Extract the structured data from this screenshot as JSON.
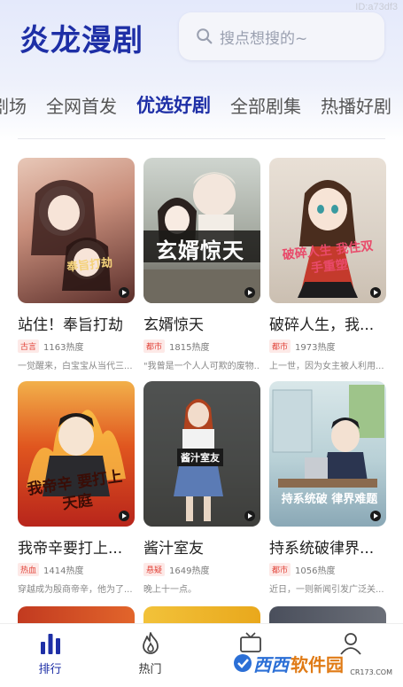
{
  "watermark_id": "ID:a73df3",
  "app": {
    "title": "炎龙漫剧"
  },
  "search": {
    "placeholder": "搜点想搜的~"
  },
  "tabs": [
    "剧场",
    "全网首发",
    "优选好剧",
    "全部剧集",
    "热播好剧"
  ],
  "active_tab": "优选好剧",
  "colors": {
    "brand": "#1e2fa6",
    "tag": "#e2463c",
    "tag_bg": "#fde9e7"
  },
  "cards": [
    {
      "title": "站住！奉旨打劫",
      "tag": "古言",
      "heat": "1163热度",
      "desc": "一觉醒来，白宝宝从当代三...",
      "poster_text": "奉旨打劫"
    },
    {
      "title": "玄婿惊天",
      "tag": "都市",
      "heat": "1815热度",
      "desc": "\"我曾是一个人人可欺的废物...",
      "poster_text": "玄婿惊天"
    },
    {
      "title": "破碎人生，我...",
      "tag": "都市",
      "heat": "1973热度",
      "desc": "上一世，因为女主被人利用...",
      "poster_text": "破碎人生 我住双手重塑"
    },
    {
      "title": "我帝辛要打上...",
      "tag": "热血",
      "heat": "1414热度",
      "desc": "穿越成为殷商帝辛，他为了...",
      "poster_text": "我帝辛 要打上天庭"
    },
    {
      "title": "酱汁室友",
      "tag": "悬疑",
      "heat": "1649热度",
      "desc": "晚上十一点。",
      "poster_text": "酱汁室友"
    },
    {
      "title": "持系统破律界...",
      "tag": "都市",
      "heat": "1056热度",
      "desc": "近日，一则新闻引发广泛关...",
      "poster_text": "持系统破 律界难题"
    }
  ],
  "bottom_nav": [
    {
      "label": "排行",
      "icon": "ranking-icon"
    },
    {
      "label": "热门",
      "icon": "fire-icon"
    },
    {
      "label": "",
      "icon": "tv-icon"
    },
    {
      "label": "",
      "icon": "user-icon"
    }
  ],
  "site_watermark": {
    "brand1": "西西",
    "brand2": "软件园",
    "url": "CR173.COM"
  }
}
